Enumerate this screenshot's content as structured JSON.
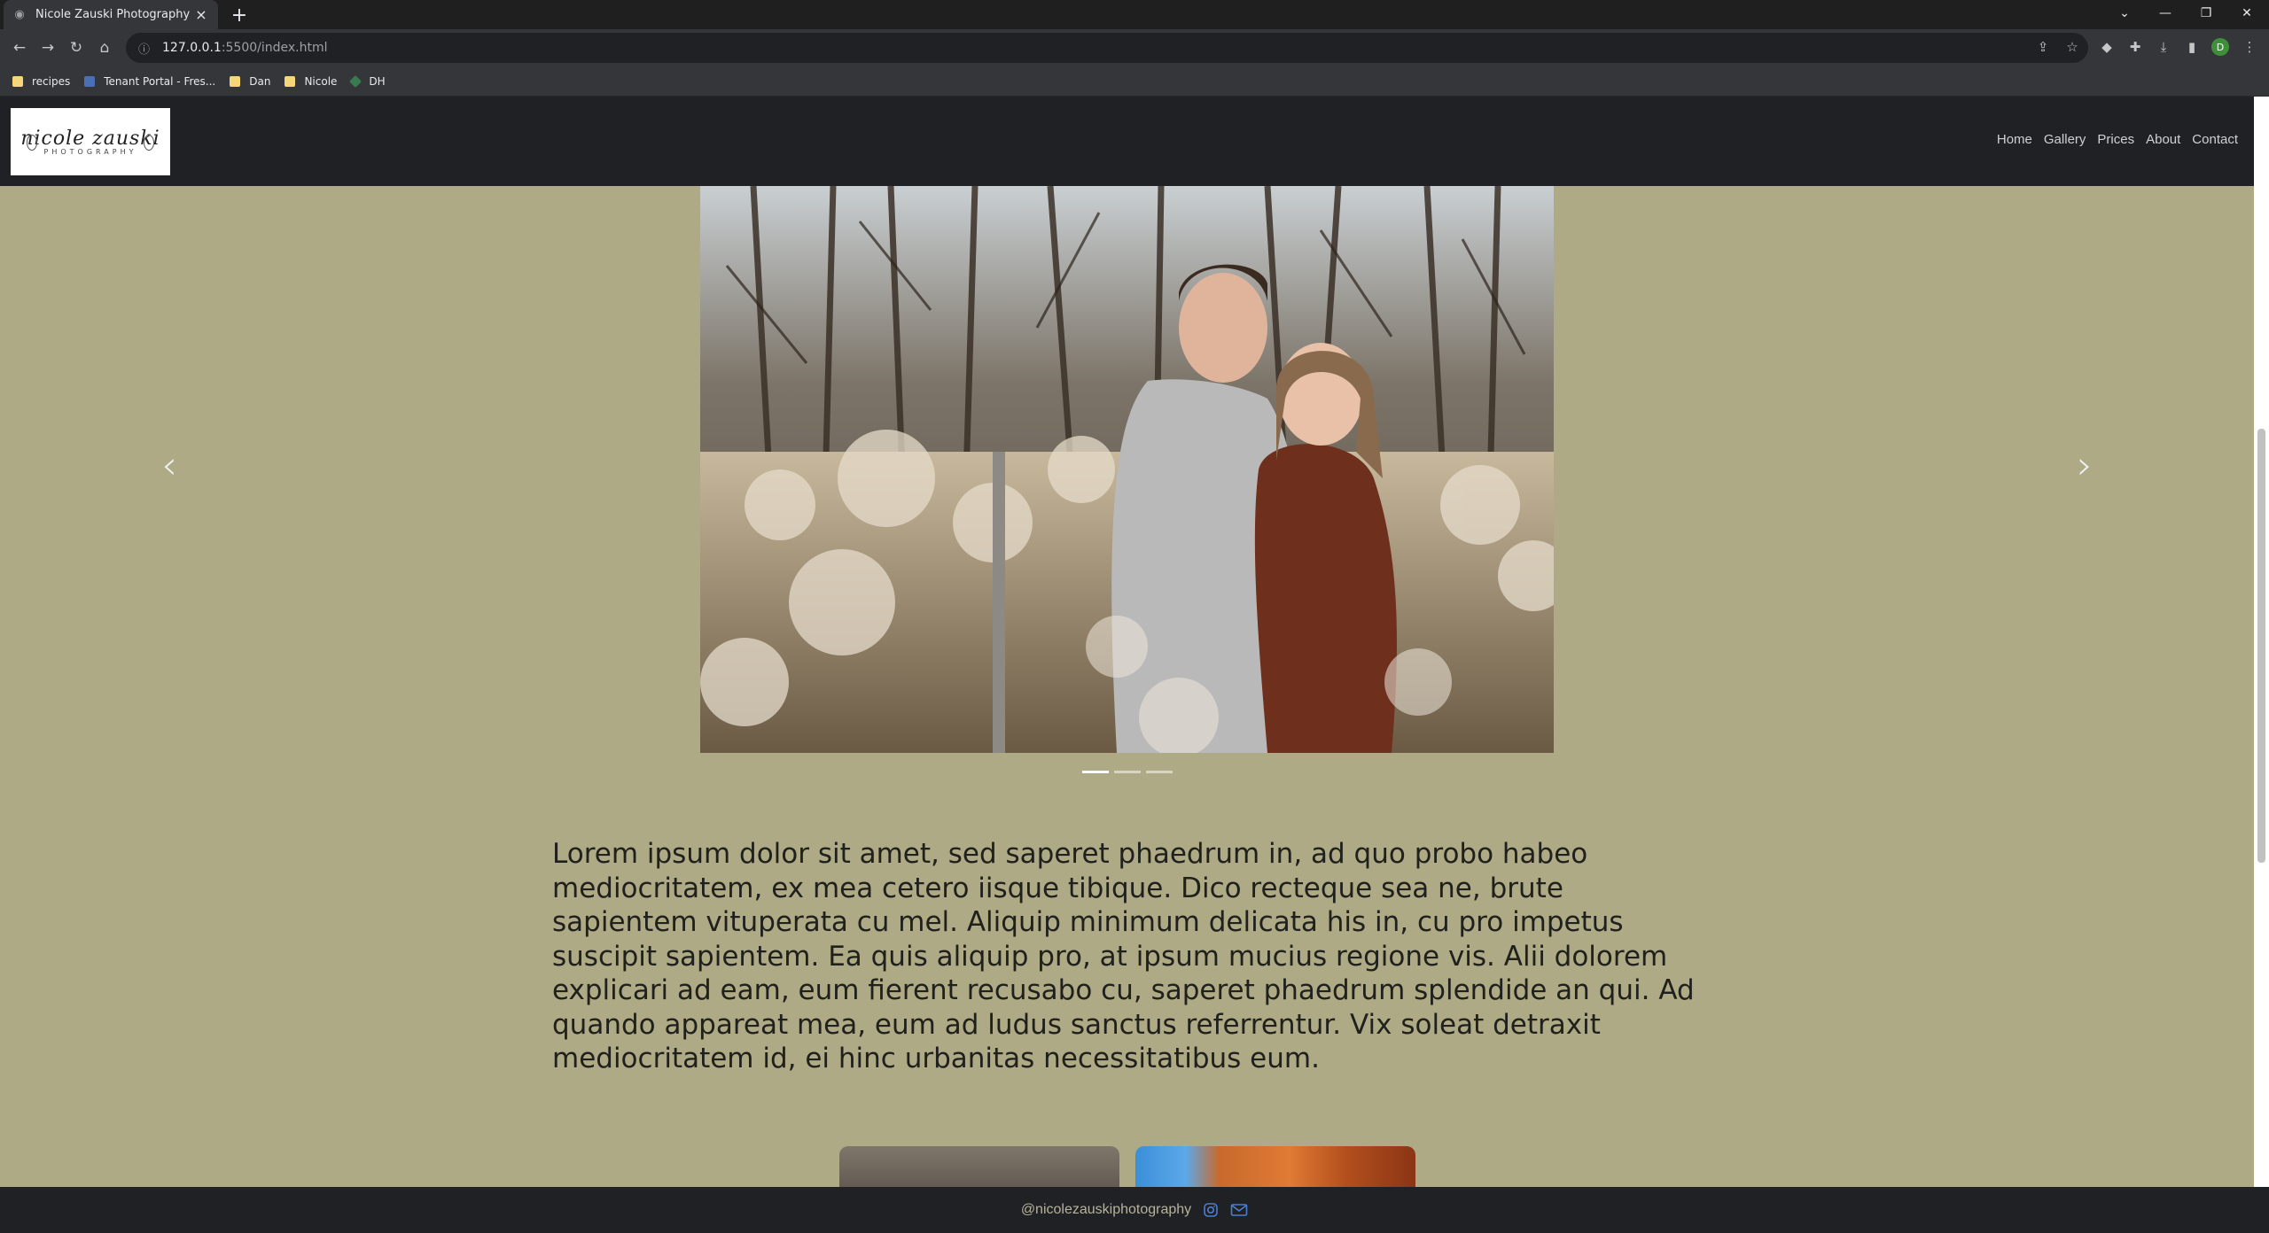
{
  "browser": {
    "tab_title": "Nicole Zauski Photography",
    "new_tab_symbol": "+",
    "close_symbol": "×",
    "url_host": "127.0.0.1",
    "url_rest": ":5500/index.html",
    "profile_initial": "D",
    "bookmarks": [
      {
        "label": "recipes",
        "icon": "folder-icon"
      },
      {
        "label": "Tenant Portal - Fres...",
        "icon": "portal-icon"
      },
      {
        "label": "Dan",
        "icon": "folder-icon"
      },
      {
        "label": "Nicole",
        "icon": "folder-icon"
      },
      {
        "label": "DH",
        "icon": "dh-icon"
      }
    ]
  },
  "site": {
    "logo_script": "nicole zauski",
    "logo_caps": "PHOTOGRAPHY",
    "nav": [
      "Home",
      "Gallery",
      "Prices",
      "About",
      "Contact"
    ],
    "carousel": {
      "prev_symbol": "‹",
      "next_symbol": "›",
      "slide_count": 3,
      "active_index": 0
    },
    "intro_text": "Lorem ipsum dolor sit amet, sed saperet phaedrum in, ad quo probo habeo mediocritatem, ex mea cetero iisque tibique. Dico recteque sea ne, brute sapientem vituperata cu mel. Aliquip minimum delicata his in, cu pro impetus suscipit sapientem. Ea quis aliquip pro, at ipsum mucius regione vis. Alii dolorem explicari ad eam, eum fierent recusabo cu, saperet phaedrum splendide an qui. Ad quando appareat mea, eum ad ludus sanctus referrentur. Vix soleat detraxit mediocritatem id, ei hinc urbanitas necessitatibus eum.",
    "footer_handle": "@nicolezauskiphotography"
  },
  "colors": {
    "page_bg": "#aeaa85",
    "header_bg": "#1f2125",
    "footer_text": "#b8b39a",
    "footer_icon": "#4a7fd0"
  }
}
